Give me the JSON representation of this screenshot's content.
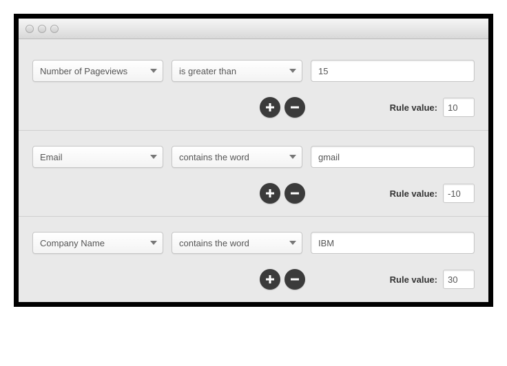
{
  "labels": {
    "rule_value": "Rule value:"
  },
  "rules": [
    {
      "field": "Number of Pageviews",
      "operator": "is greater than",
      "value": "15",
      "rule_value": "10"
    },
    {
      "field": "Email",
      "operator": "contains the word",
      "value": "gmail",
      "rule_value": "-10"
    },
    {
      "field": "Company Name",
      "operator": "contains the word",
      "value": "IBM",
      "rule_value": "30"
    }
  ]
}
